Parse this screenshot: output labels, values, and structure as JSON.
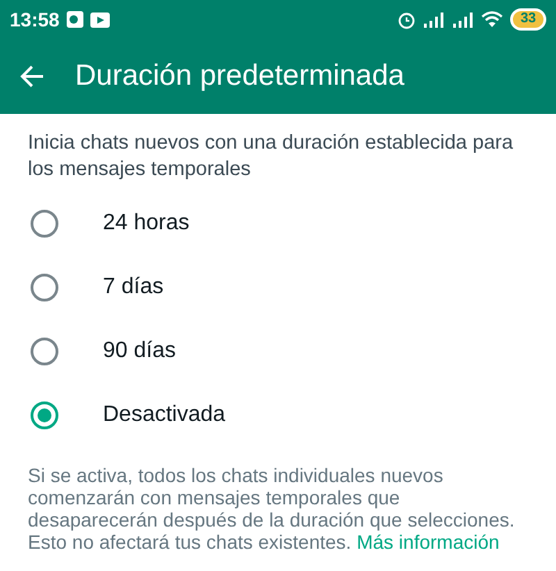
{
  "status_bar": {
    "time": "13:58",
    "battery": "33"
  },
  "app_bar": {
    "title": "Duración predeterminada"
  },
  "description": "Inicia chats nuevos con una duración establecida para los mensajes temporales",
  "options": [
    {
      "label": "24 horas",
      "selected": false
    },
    {
      "label": "7 días",
      "selected": false
    },
    {
      "label": "90 días",
      "selected": false
    },
    {
      "label": "Desactivada",
      "selected": true
    }
  ],
  "footer": {
    "text": "Si se activa, todos los chats individuales nuevos comenzarán con mensajes temporales que desaparecerán después de la duración que selecciones. Esto no afectará tus chats existentes.",
    "link": "Más información"
  }
}
